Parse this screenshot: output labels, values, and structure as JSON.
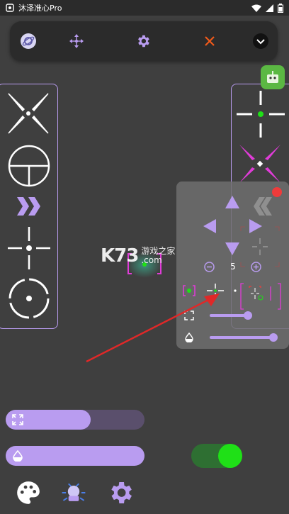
{
  "status_bar": {
    "app_name": "沐泽准心Pro"
  },
  "popup": {
    "size_value": "5"
  },
  "watermark": {
    "logo": "K73",
    "line1": "游戏之家",
    "line2": ".com"
  },
  "colors": {
    "accent": "#b99cf0",
    "close": "#f05a1a",
    "toggle_on": "#1fe017",
    "magenta": "#e03cd8"
  },
  "bottom": {
    "size_fill": 0.61,
    "opacity_fill": 1.0,
    "toggle_state": "on"
  },
  "popup_sliders": {
    "size": 0.6,
    "opacity": 1.0
  }
}
